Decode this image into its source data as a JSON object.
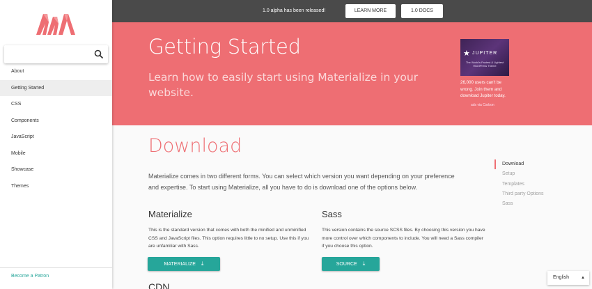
{
  "topbar": {
    "message": "1.0 alpha has been released!",
    "learn_more": "LEARN MORE",
    "docs": "1.0 DOCS"
  },
  "sidebar": {
    "logo_icon": "materialize-logo",
    "search": {
      "value": "",
      "icon": "search-icon"
    },
    "items": [
      {
        "label": "About",
        "active": false
      },
      {
        "label": "Getting Started",
        "active": true
      },
      {
        "label": "CSS",
        "active": false
      },
      {
        "label": "Components",
        "active": false
      },
      {
        "label": "JavaScript",
        "active": false
      },
      {
        "label": "Mobile",
        "active": false
      },
      {
        "label": "Showcase",
        "active": false
      },
      {
        "label": "Themes",
        "active": false
      }
    ],
    "footer_link": "Become a Patron"
  },
  "hero": {
    "title": "Getting Started",
    "subtitle": "Learn how to easily start using Materialize in your website.",
    "ad": {
      "brand": "JUPITER",
      "tagline": "The World's Fastest & Lightest WordPress Theme",
      "text": "26,000 users can't be wrong. Join them and download Jupiter today.",
      "via": "ads via Carbon"
    }
  },
  "content": {
    "heading": "Download",
    "intro": "Materialize comes in two different forms. You can select which version you want depending on your preference and expertise. To start using Materialize, all you have to do is download one of the options below.",
    "materialize": {
      "title": "Materialize",
      "text": "This is the standard version that comes with both the minified and unminified CSS and JavaScript files. This option requires little to no setup. Use this if you are unfamiliar with Sass.",
      "button": "MATERIALIZE"
    },
    "sass": {
      "title": "Sass",
      "text": "This version contains the source SCSS files. By choosing this version you have more control over which components to include. You will need a Sass compiler if you choose this option.",
      "button": "SOURCE"
    },
    "next_heading": "CDN"
  },
  "toc": [
    {
      "label": "Download",
      "active": true
    },
    {
      "label": "Setup",
      "active": false
    },
    {
      "label": "Templates",
      "active": false
    },
    {
      "label": "Third party Options",
      "active": false
    },
    {
      "label": "Sass",
      "active": false
    }
  ],
  "language": {
    "selected": "English",
    "caret_icon": "caret-up-icon"
  },
  "colors": {
    "accent": "#ee6e73",
    "teal": "#26a69a",
    "topbar": "#4a4a4a"
  }
}
